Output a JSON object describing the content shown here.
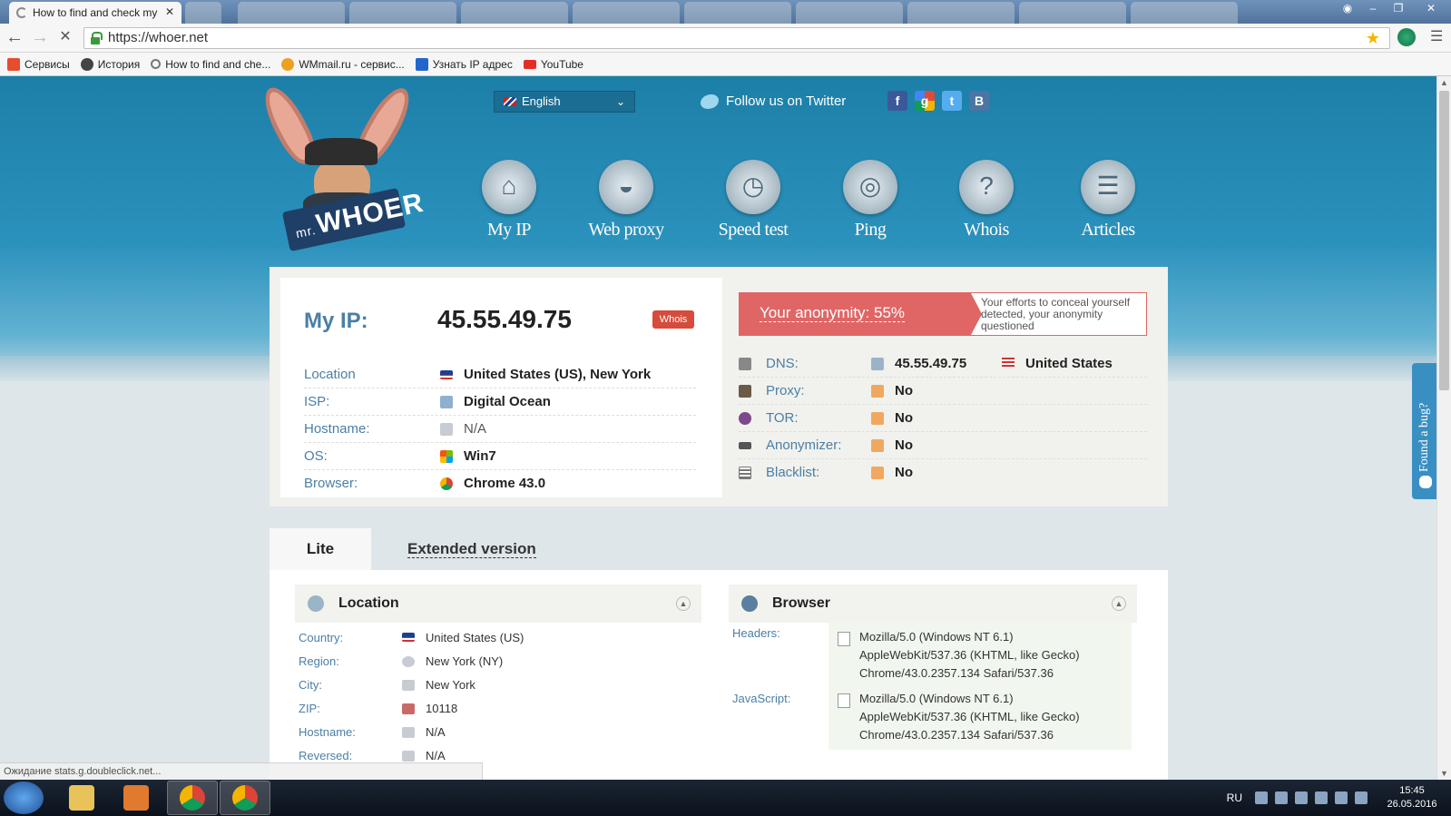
{
  "browser": {
    "active_tab_title": "How to find and check my",
    "url": "https://whoer.net",
    "window_controls": [
      "minimize-icon",
      "restore-icon",
      "close-icon"
    ]
  },
  "bookmarks": [
    {
      "label": "Сервисы",
      "icon": "apps-icon",
      "color": "#e54d2e"
    },
    {
      "label": "История",
      "icon": "history-icon",
      "color": "#444444"
    },
    {
      "label": "How to find and che...",
      "icon": "search-icon",
      "color": "#777777"
    },
    {
      "label": "WMmail.ru - сервис...",
      "icon": "wmmail-icon",
      "color": "#f0a020"
    },
    {
      "label": "Узнать IP адрес",
      "icon": "ip-icon",
      "color": "#2266cc"
    },
    {
      "label": "YouTube",
      "icon": "youtube-icon",
      "color": "#e52d27"
    }
  ],
  "header": {
    "logo_prefix": "mr.",
    "logo_text": "WHOER",
    "language": "English",
    "follow_twitter": "Follow us on Twitter",
    "social": [
      {
        "name": "facebook-icon",
        "glyph": "f",
        "color": "#3b5998"
      },
      {
        "name": "google-icon",
        "glyph": "g",
        "color": "#dd4b39"
      },
      {
        "name": "twitter-icon",
        "glyph": "t",
        "color": "#55acee"
      },
      {
        "name": "vk-icon",
        "glyph": "B",
        "color": "#4c75a3"
      }
    ]
  },
  "nav": [
    {
      "label": "My IP",
      "icon": "home-icon",
      "glyph": "⌂"
    },
    {
      "label": "Web proxy",
      "icon": "spy-hat-icon",
      "glyph": "◒"
    },
    {
      "label": "Speed test",
      "icon": "speedometer-icon",
      "glyph": "◷"
    },
    {
      "label": "Ping",
      "icon": "radar-icon",
      "glyph": "◎"
    },
    {
      "label": "Whois",
      "icon": "question-icon",
      "glyph": "?"
    },
    {
      "label": "Articles",
      "icon": "document-icon",
      "glyph": "☰"
    }
  ],
  "ip_info": {
    "label": "My IP:",
    "ip": "45.55.49.75",
    "whois_badge": "Whois",
    "rows": [
      {
        "key": "Location",
        "value": "United States (US), New York",
        "icon": "us-flag-icon",
        "bold": true
      },
      {
        "key": "ISP:",
        "value": "Digital Ocean",
        "icon": "isp-icon",
        "bold": true
      },
      {
        "key": "Hostname:",
        "value": "N/A",
        "icon": "server-icon",
        "bold": false
      },
      {
        "key": "OS:",
        "value": "Win7",
        "icon": "windows-icon",
        "bold": true
      },
      {
        "key": "Browser:",
        "value": "Chrome 43.0",
        "icon": "chrome-icon",
        "bold": true
      }
    ]
  },
  "anonymity": {
    "label": "Your anonymity: 55%",
    "percent": 55,
    "message": "Your efforts to conceal yourself detected, your anonymity questioned",
    "rows": [
      {
        "key": "DNS:",
        "value": "45.55.49.75",
        "icon": "dns-icon",
        "extra": "United States"
      },
      {
        "key": "Proxy:",
        "value": "No",
        "icon": "spy-icon"
      },
      {
        "key": "TOR:",
        "value": "No",
        "icon": "tor-onion-icon"
      },
      {
        "key": "Anonymizer:",
        "value": "No",
        "icon": "glasses-icon"
      },
      {
        "key": "Blacklist:",
        "value": "No",
        "icon": "list-icon"
      }
    ]
  },
  "version_tabs": {
    "lite": "Lite",
    "extended": "Extended version"
  },
  "location_section": {
    "title": "Location",
    "rows": [
      {
        "key": "Country:",
        "value": "United States (US)"
      },
      {
        "key": "Region:",
        "value": "New York (NY)"
      },
      {
        "key": "City:",
        "value": "New York"
      },
      {
        "key": "ZIP:",
        "value": "10118"
      },
      {
        "key": "Hostname:",
        "value": "N/A"
      },
      {
        "key": "Reversed:",
        "value": "N/A"
      }
    ]
  },
  "browser_section": {
    "title": "Browser",
    "headers_label": "Headers:",
    "headers_value": "Mozilla/5.0 (Windows NT 6.1) AppleWebKit/537.36 (KHTML, like Gecko) Chrome/43.0.2357.134 Safari/537.36",
    "js_label": "JavaScript:",
    "js_value": "Mozilla/5.0 (Windows NT 6.1) AppleWebKit/537.36 (KHTML, like Gecko) Chrome/43.0.2357.134 Safari/537.36"
  },
  "bug_tab": "Found a bug?",
  "status_bar": "Ожидание stats.g.doubleclick.net...",
  "taskbar": {
    "language": "RU",
    "time": "15:45",
    "date": "26.05.2016"
  },
  "colors": {
    "accent": "#4a7fa6",
    "warning": "#e06666",
    "hero": "#2b92bd"
  }
}
